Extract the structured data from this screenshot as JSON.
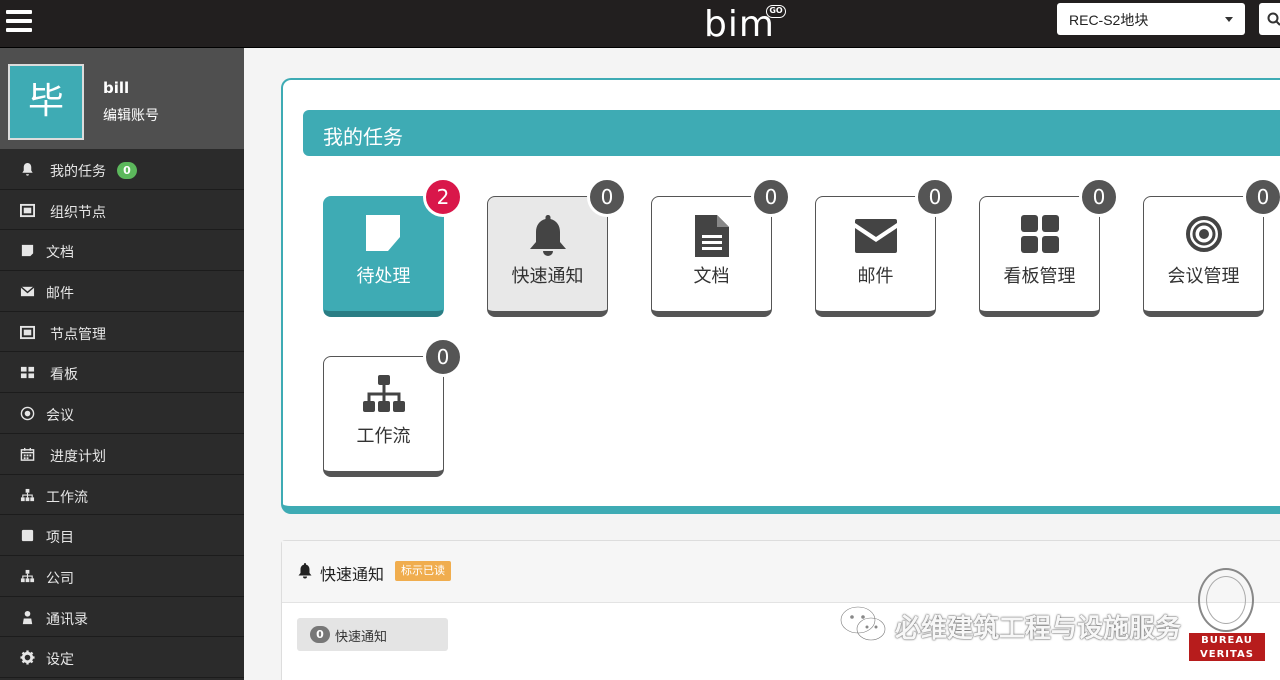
{
  "topbar": {
    "logo_text": "bim",
    "logo_badge": "GO",
    "project_value": "REC-S2地块"
  },
  "profile": {
    "avatar_char": "毕",
    "username": "bill",
    "edit_label": "编辑账号"
  },
  "sidebar": {
    "items": [
      {
        "label": "我的任务",
        "icon": "bell-icon",
        "badge": "0"
      },
      {
        "label": "组织节点",
        "icon": "org-node-icon"
      },
      {
        "label": "文档",
        "icon": "document-icon"
      },
      {
        "label": "邮件",
        "icon": "mail-icon"
      },
      {
        "label": "节点管理",
        "icon": "node-manage-icon"
      },
      {
        "label": "看板",
        "icon": "dashboard-icon"
      },
      {
        "label": "会议",
        "icon": "target-icon"
      },
      {
        "label": "进度计划",
        "icon": "calendar-icon"
      },
      {
        "label": "工作流",
        "icon": "sitemap-icon"
      },
      {
        "label": "项目",
        "icon": "project-icon"
      },
      {
        "label": "公司",
        "icon": "sitemap-icon"
      },
      {
        "label": "通讯录",
        "icon": "contacts-icon"
      },
      {
        "label": "设定",
        "icon": "gear-icon"
      }
    ]
  },
  "tasks": {
    "title": "我的任务",
    "tiles": [
      {
        "label": "待处理",
        "count": "2",
        "icon": "sticky-note-icon"
      },
      {
        "label": "快速通知",
        "count": "0",
        "icon": "bell-icon"
      },
      {
        "label": "文档",
        "count": "0",
        "icon": "file-text-icon"
      },
      {
        "label": "邮件",
        "count": "0",
        "icon": "envelope-icon"
      },
      {
        "label": "看板管理",
        "count": "0",
        "icon": "dashboard-icon"
      },
      {
        "label": "会议管理",
        "count": "0",
        "icon": "target-icon"
      },
      {
        "label": "工作流",
        "count": "0",
        "icon": "sitemap-icon"
      }
    ]
  },
  "notify": {
    "title": "快速通知",
    "mark_read": "标示已读",
    "item_count": "0",
    "item_label": "快速通知"
  },
  "watermark": {
    "text": "必维建筑工程与设施服务",
    "logo_top": "BUREAU VERITAS",
    "logo_line1": "BUREAU",
    "logo_line2": "VERITAS"
  },
  "colors": {
    "accent": "#3eabb4",
    "topbar": "#221f1f",
    "sidebar": "#2b2b2b",
    "badge_red": "#d9174a",
    "badge_green": "#5cb85c",
    "warning": "#f0ad4e"
  }
}
